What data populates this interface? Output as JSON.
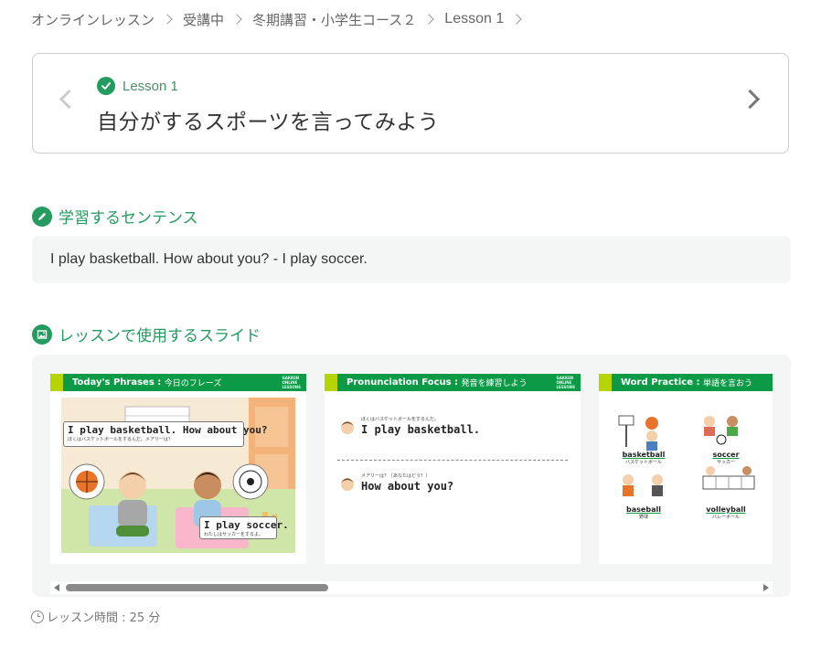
{
  "breadcrumb": {
    "items": [
      "オンラインレッスン",
      "受講中",
      "冬期講習・小学生コース２",
      "Lesson 1"
    ]
  },
  "lesson": {
    "label": "Lesson 1",
    "title": "自分がするスポーツを言ってみよう"
  },
  "sentence_section": {
    "title": "学習するセンテンス",
    "sentence": "I play basketball. How about you? - I play soccer."
  },
  "slides_section": {
    "title": "レッスンで使用するスライド",
    "slides": [
      {
        "header_en": "Today's Phrases",
        "header_ja": "今日のフレーズ",
        "bubble1_en": "I play basketball. How about you?",
        "bubble1_ja": "ぼくはバスケットボールをするんだ。メアリーは？",
        "bubble2_en": "I play soccer.",
        "bubble2_ja": "わたしはサッカーをするよ。"
      },
      {
        "header_en": "Pronunciation Focus",
        "header_ja": "発音を練習しよう",
        "line1_ja": "ぼくはバスケットボールをするんだ。",
        "line1_en": "I play basketball.",
        "line2_ja": "メアリーは？［あなたはどう？］",
        "line2_en": "How about you?"
      },
      {
        "header_en": "Word Practice",
        "header_ja": "単語を言おう",
        "words": [
          {
            "en": "basketball",
            "ja": "バスケットボール"
          },
          {
            "en": "soccer",
            "ja": "サッカー"
          },
          {
            "en": "baseball",
            "ja": "野球"
          },
          {
            "en": "volleyball",
            "ja": "バレーボール"
          }
        ]
      }
    ]
  },
  "duration": "レッスン時間 : 25 分",
  "colors": {
    "accent": "#249b5f",
    "slide_header": "#0d9a47",
    "slide_tab": "#b6d400"
  },
  "icons": [
    "chevron-right-icon",
    "check-circle-icon",
    "pencil-icon",
    "image-icon",
    "clock-icon"
  ]
}
